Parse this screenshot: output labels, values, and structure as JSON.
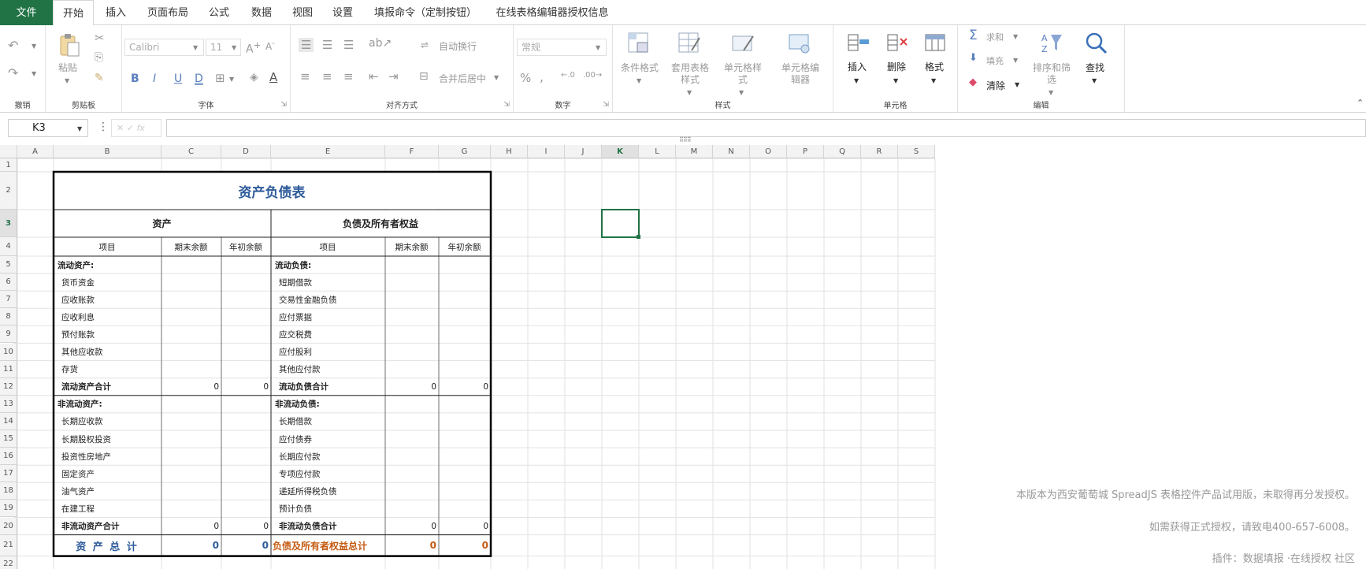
{
  "menu": {
    "file": "文件",
    "tabs": [
      "开始",
      "插入",
      "页面布局",
      "公式",
      "数据",
      "视图",
      "设置",
      "填报命令（定制按钮）",
      "在线表格编辑器授权信息"
    ]
  },
  "ribbon": {
    "undo_group": "撤销",
    "clipboard": {
      "paste": "粘贴",
      "group": "剪贴板"
    },
    "font": {
      "name": "Calibri",
      "size": "11",
      "bold": "B",
      "italic": "I",
      "underline": "U",
      "double_underline": "D",
      "group": "字体"
    },
    "align": {
      "wrap": "自动换行",
      "merge": "合并后居中",
      "group": "对齐方式"
    },
    "number": {
      "format": "常规",
      "group": "数字"
    },
    "styles": {
      "conditional": "条件格式",
      "table_style": "套用表格样式",
      "cell_style": "单元格样式",
      "cell_editor": "单元格编辑器",
      "group": "样式"
    },
    "cells": {
      "insert": "插入",
      "delete": "删除",
      "format": "格式",
      "group": "单元格"
    },
    "editing": {
      "sum": "求和",
      "fill": "填充",
      "clear": "清除",
      "sort": "排序和筛选",
      "find": "查找",
      "group": "编辑"
    }
  },
  "formula_bar": {
    "cell_ref": "K3",
    "fx": "fx",
    "value": ""
  },
  "colors": {
    "accent": "#217346",
    "title_blue": "#2e5b9a",
    "total_orange": "#c55a11"
  },
  "columns": [
    "A",
    "B",
    "C",
    "D",
    "E",
    "F",
    "G",
    "H",
    "I",
    "J",
    "K",
    "L",
    "M",
    "N",
    "O",
    "P",
    "Q",
    "R",
    "S"
  ],
  "selected_column": "K",
  "selected_row": "3",
  "rows": [
    "1",
    "2",
    "3",
    "4",
    "5",
    "6",
    "7",
    "8",
    "9",
    "10",
    "11",
    "12",
    "13",
    "14",
    "15",
    "16",
    "17",
    "18",
    "19",
    "20",
    "21",
    "22"
  ],
  "sheet": {
    "title": "资产负债表",
    "assets_header": "资产",
    "liab_header": "负债及所有者权益",
    "col_item": "项目",
    "col_end": "期末余额",
    "col_begin": "年初余额",
    "left": [
      {
        "label": "流动资产:",
        "bold": true,
        "end": "",
        "begin": ""
      },
      {
        "label": "货币资金",
        "bold": false,
        "end": "",
        "begin": ""
      },
      {
        "label": "应收账款",
        "bold": false,
        "end": "",
        "begin": ""
      },
      {
        "label": "应收利息",
        "bold": false,
        "end": "",
        "begin": ""
      },
      {
        "label": "预付账款",
        "bold": false,
        "end": "",
        "begin": ""
      },
      {
        "label": "其他应收款",
        "bold": false,
        "end": "",
        "begin": ""
      },
      {
        "label": "存货",
        "bold": false,
        "end": "",
        "begin": ""
      },
      {
        "label": "流动资产合计",
        "bold": true,
        "end": "0",
        "begin": "0"
      },
      {
        "label": "非流动资产:",
        "bold": true,
        "end": "",
        "begin": ""
      },
      {
        "label": "长期应收款",
        "bold": false,
        "end": "",
        "begin": ""
      },
      {
        "label": "长期股权投资",
        "bold": false,
        "end": "",
        "begin": ""
      },
      {
        "label": "投资性房地产",
        "bold": false,
        "end": "",
        "begin": ""
      },
      {
        "label": "固定资产",
        "bold": false,
        "end": "",
        "begin": ""
      },
      {
        "label": "油气资产",
        "bold": false,
        "end": "",
        "begin": ""
      },
      {
        "label": "在建工程",
        "bold": false,
        "end": "",
        "begin": ""
      },
      {
        "label": "非流动资产合计",
        "bold": true,
        "end": "0",
        "begin": "0"
      }
    ],
    "right": [
      {
        "label": "流动负债:",
        "bold": true,
        "end": "",
        "begin": ""
      },
      {
        "label": "短期借款",
        "bold": false,
        "end": "",
        "begin": ""
      },
      {
        "label": "交易性金融负债",
        "bold": false,
        "end": "",
        "begin": ""
      },
      {
        "label": "应付票据",
        "bold": false,
        "end": "",
        "begin": ""
      },
      {
        "label": "应交税费",
        "bold": false,
        "end": "",
        "begin": ""
      },
      {
        "label": "应付股利",
        "bold": false,
        "end": "",
        "begin": ""
      },
      {
        "label": "其他应付款",
        "bold": false,
        "end": "",
        "begin": ""
      },
      {
        "label": "流动负债合计",
        "bold": true,
        "end": "0",
        "begin": "0"
      },
      {
        "label": "非流动负债:",
        "bold": true,
        "end": "",
        "begin": ""
      },
      {
        "label": "长期借款",
        "bold": false,
        "end": "",
        "begin": ""
      },
      {
        "label": "应付债券",
        "bold": false,
        "end": "",
        "begin": ""
      },
      {
        "label": "长期应付款",
        "bold": false,
        "end": "",
        "begin": ""
      },
      {
        "label": "专项应付款",
        "bold": false,
        "end": "",
        "begin": ""
      },
      {
        "label": "递延所得税负债",
        "bold": false,
        "end": "",
        "begin": ""
      },
      {
        "label": "预计负债",
        "bold": false,
        "end": "",
        "begin": ""
      },
      {
        "label": "非流动负债合计",
        "bold": true,
        "end": "0",
        "begin": "0"
      }
    ],
    "total_assets": {
      "label": "资 产 总 计",
      "end": "0",
      "begin": "0"
    },
    "total_liab": {
      "label": "负债及所有者权益总计",
      "end": "0",
      "begin": "0"
    }
  },
  "watermark": {
    "line1": "本版本为西安葡萄城 SpreadJS 表格控件产品试用版，未取得再分发授权。",
    "line2": "如需获得正式授权，请致电400-657-6008。",
    "line3": "插件：数据填报 ·在线授权 社区"
  }
}
